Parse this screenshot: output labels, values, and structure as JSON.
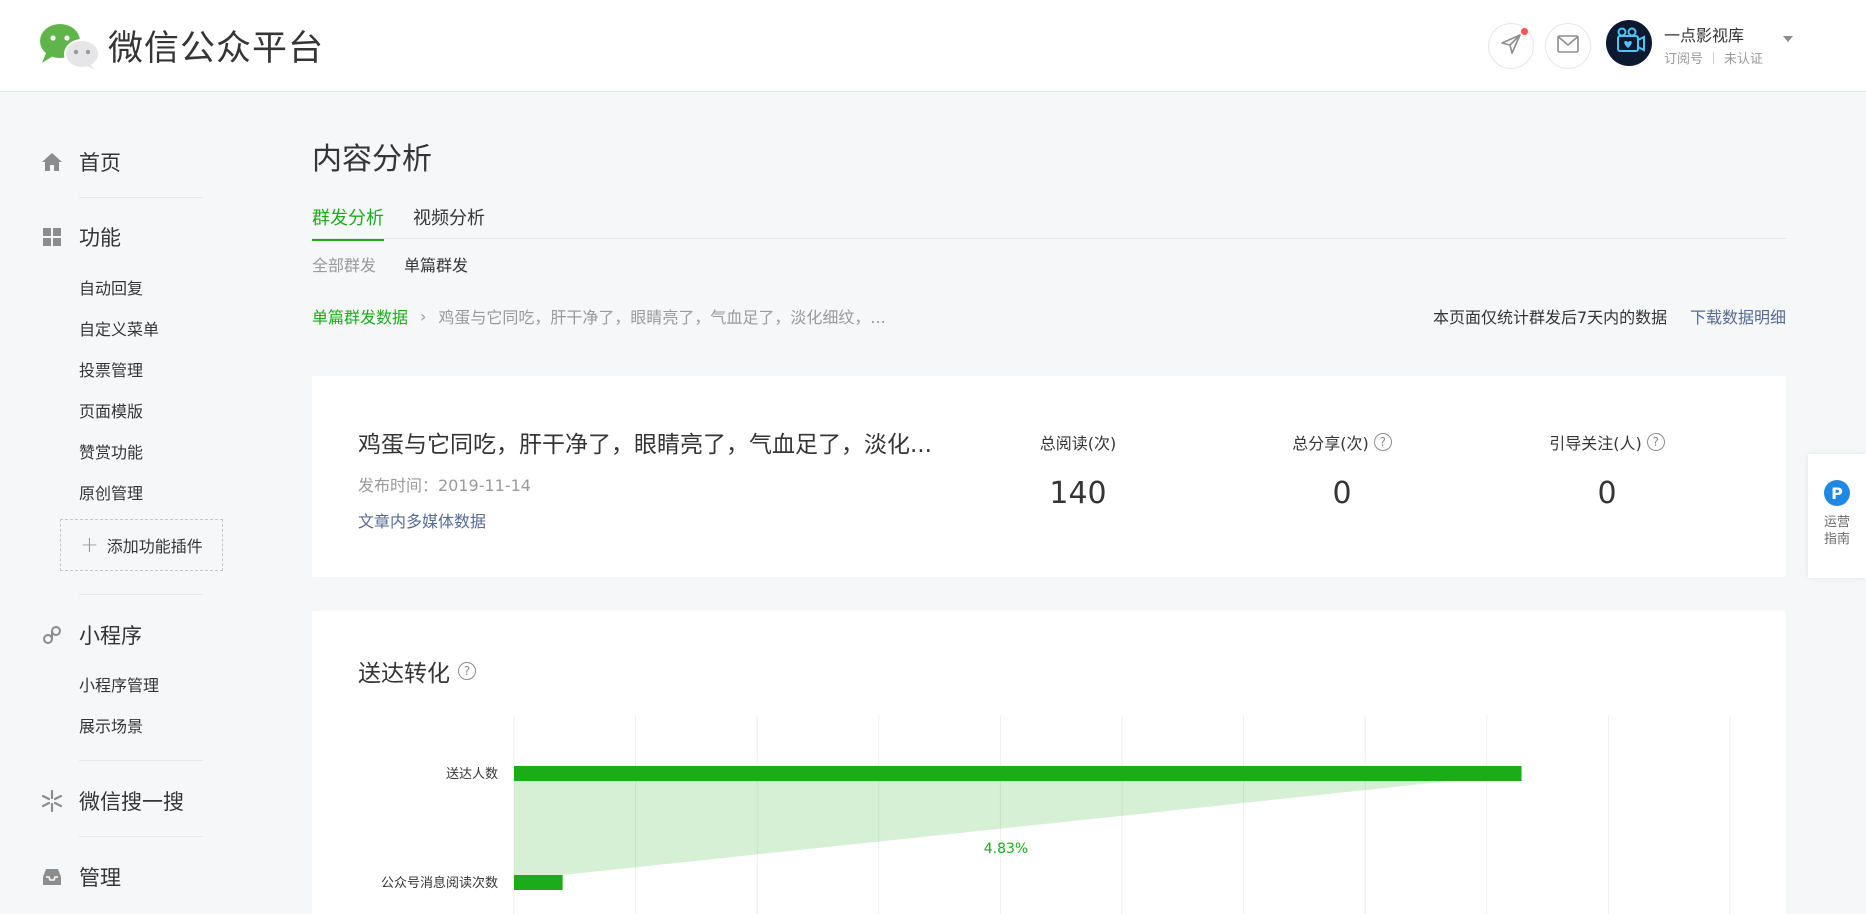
{
  "header": {
    "app_title": "微信公众平台",
    "account_name": "一点影视库",
    "account_type": "订阅号",
    "account_status": "未认证"
  },
  "sidebar": {
    "home_label": "首页",
    "func_label": "功能",
    "func_items": [
      "自动回复",
      "自定义菜单",
      "投票管理",
      "页面模版",
      "赞赏功能",
      "原创管理"
    ],
    "add_plugin_label": "添加功能插件",
    "mini_label": "小程序",
    "mini_items": [
      "小程序管理",
      "展示场景"
    ],
    "search_label": "微信搜一搜",
    "manage_label": "管理"
  },
  "main": {
    "page_title": "内容分析",
    "tabs": [
      {
        "label": "群发分析"
      },
      {
        "label": "视频分析"
      }
    ],
    "subtabs": [
      {
        "label": "全部群发"
      },
      {
        "label": "单篇群发"
      }
    ],
    "breadcrumb_link": "单篇群发数据",
    "breadcrumb_current": "鸡蛋与它同吃，肝干净了，眼睛亮了，气血足了，淡化细纹，...",
    "range_note": "本页面仅统计群发后7天内的数据",
    "download_label": "下载数据明细"
  },
  "article": {
    "title": "鸡蛋与它同吃，肝干净了，眼睛亮了，气血足了，淡化...",
    "date_text": "发布时间：2019-11-14",
    "media_link": "文章内多媒体数据",
    "stats": [
      {
        "label": "总阅读(次)",
        "value": "140"
      },
      {
        "label": "总分享(次)",
        "value": "0"
      },
      {
        "label": "引导关注(人)",
        "value": "0"
      }
    ]
  },
  "delivery": {
    "title": "送达转化"
  },
  "chart_data": {
    "type": "bar",
    "categories": [
      "送达人数",
      "公众号消息阅读次数"
    ],
    "values": [
      2900,
      140
    ],
    "conversion_label": "4.83%",
    "bar_color": "#1aad19"
  },
  "float_guide": {
    "label": "运营指南",
    "icon_text": "P"
  },
  "colors": {
    "accent_green": "#1aad19",
    "link_blue": "#576b95"
  }
}
